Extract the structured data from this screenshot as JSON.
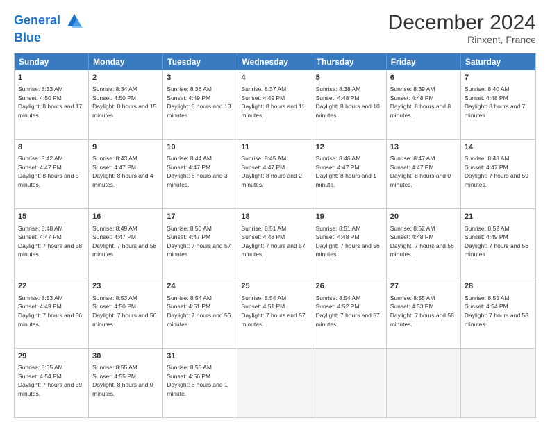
{
  "header": {
    "logo_line1": "General",
    "logo_line2": "Blue",
    "title": "December 2024",
    "subtitle": "Rinxent, France"
  },
  "days_of_week": [
    "Sunday",
    "Monday",
    "Tuesday",
    "Wednesday",
    "Thursday",
    "Friday",
    "Saturday"
  ],
  "weeks": [
    [
      {
        "day": 1,
        "sunrise": "8:33 AM",
        "sunset": "4:50 PM",
        "daylight": "8 hours and 17 minutes."
      },
      {
        "day": 2,
        "sunrise": "8:34 AM",
        "sunset": "4:50 PM",
        "daylight": "8 hours and 15 minutes."
      },
      {
        "day": 3,
        "sunrise": "8:36 AM",
        "sunset": "4:49 PM",
        "daylight": "8 hours and 13 minutes."
      },
      {
        "day": 4,
        "sunrise": "8:37 AM",
        "sunset": "4:49 PM",
        "daylight": "8 hours and 11 minutes."
      },
      {
        "day": 5,
        "sunrise": "8:38 AM",
        "sunset": "4:48 PM",
        "daylight": "8 hours and 10 minutes."
      },
      {
        "day": 6,
        "sunrise": "8:39 AM",
        "sunset": "4:48 PM",
        "daylight": "8 hours and 8 minutes."
      },
      {
        "day": 7,
        "sunrise": "8:40 AM",
        "sunset": "4:48 PM",
        "daylight": "8 hours and 7 minutes."
      }
    ],
    [
      {
        "day": 8,
        "sunrise": "8:42 AM",
        "sunset": "4:47 PM",
        "daylight": "8 hours and 5 minutes."
      },
      {
        "day": 9,
        "sunrise": "8:43 AM",
        "sunset": "4:47 PM",
        "daylight": "8 hours and 4 minutes."
      },
      {
        "day": 10,
        "sunrise": "8:44 AM",
        "sunset": "4:47 PM",
        "daylight": "8 hours and 3 minutes."
      },
      {
        "day": 11,
        "sunrise": "8:45 AM",
        "sunset": "4:47 PM",
        "daylight": "8 hours and 2 minutes."
      },
      {
        "day": 12,
        "sunrise": "8:46 AM",
        "sunset": "4:47 PM",
        "daylight": "8 hours and 1 minute."
      },
      {
        "day": 13,
        "sunrise": "8:47 AM",
        "sunset": "4:47 PM",
        "daylight": "8 hours and 0 minutes."
      },
      {
        "day": 14,
        "sunrise": "8:48 AM",
        "sunset": "4:47 PM",
        "daylight": "7 hours and 59 minutes."
      }
    ],
    [
      {
        "day": 15,
        "sunrise": "8:48 AM",
        "sunset": "4:47 PM",
        "daylight": "7 hours and 58 minutes."
      },
      {
        "day": 16,
        "sunrise": "8:49 AM",
        "sunset": "4:47 PM",
        "daylight": "7 hours and 58 minutes."
      },
      {
        "day": 17,
        "sunrise": "8:50 AM",
        "sunset": "4:47 PM",
        "daylight": "7 hours and 57 minutes."
      },
      {
        "day": 18,
        "sunrise": "8:51 AM",
        "sunset": "4:48 PM",
        "daylight": "7 hours and 57 minutes."
      },
      {
        "day": 19,
        "sunrise": "8:51 AM",
        "sunset": "4:48 PM",
        "daylight": "7 hours and 56 minutes."
      },
      {
        "day": 20,
        "sunrise": "8:52 AM",
        "sunset": "4:48 PM",
        "daylight": "7 hours and 56 minutes."
      },
      {
        "day": 21,
        "sunrise": "8:52 AM",
        "sunset": "4:49 PM",
        "daylight": "7 hours and 56 minutes."
      }
    ],
    [
      {
        "day": 22,
        "sunrise": "8:53 AM",
        "sunset": "4:49 PM",
        "daylight": "7 hours and 56 minutes."
      },
      {
        "day": 23,
        "sunrise": "8:53 AM",
        "sunset": "4:50 PM",
        "daylight": "7 hours and 56 minutes."
      },
      {
        "day": 24,
        "sunrise": "8:54 AM",
        "sunset": "4:51 PM",
        "daylight": "7 hours and 56 minutes."
      },
      {
        "day": 25,
        "sunrise": "8:54 AM",
        "sunset": "4:51 PM",
        "daylight": "7 hours and 57 minutes."
      },
      {
        "day": 26,
        "sunrise": "8:54 AM",
        "sunset": "4:52 PM",
        "daylight": "7 hours and 57 minutes."
      },
      {
        "day": 27,
        "sunrise": "8:55 AM",
        "sunset": "4:53 PM",
        "daylight": "7 hours and 58 minutes."
      },
      {
        "day": 28,
        "sunrise": "8:55 AM",
        "sunset": "4:54 PM",
        "daylight": "7 hours and 58 minutes."
      }
    ],
    [
      {
        "day": 29,
        "sunrise": "8:55 AM",
        "sunset": "4:54 PM",
        "daylight": "7 hours and 59 minutes."
      },
      {
        "day": 30,
        "sunrise": "8:55 AM",
        "sunset": "4:55 PM",
        "daylight": "8 hours and 0 minutes."
      },
      {
        "day": 31,
        "sunrise": "8:55 AM",
        "sunset": "4:56 PM",
        "daylight": "8 hours and 1 minute."
      },
      null,
      null,
      null,
      null
    ]
  ]
}
